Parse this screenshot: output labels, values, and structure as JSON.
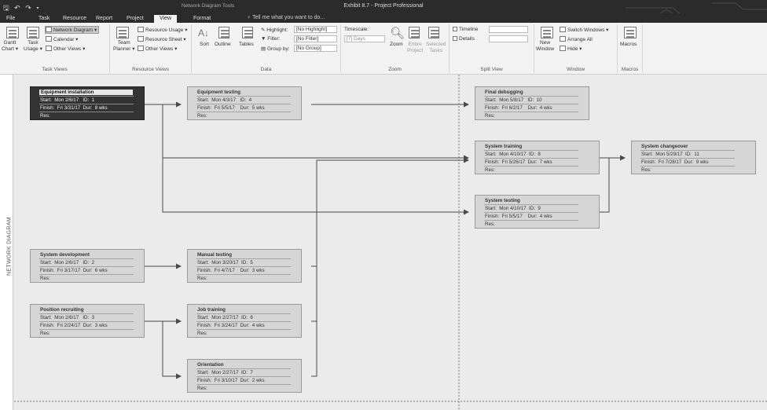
{
  "titlebar": {
    "qat": "🖫 ↶ ↷ ▾",
    "context_tools": "Network Diagram Tools",
    "window_title": "Exhibit 8.7 - Project Professional"
  },
  "tabs": [
    "File",
    "Task",
    "Resource",
    "Report",
    "Project",
    "View",
    "Format"
  ],
  "active_tab": "View",
  "tell_me": "♀ Tell me what you want to do...",
  "ribbon": {
    "task_views": {
      "gantt_chart": "Gantt\nChart ▾",
      "task_usage": "Task\nUsage ▾",
      "network_diagram": "Network Diagram ▾",
      "calendar": "Calendar ▾",
      "other_views": "Other Views ▾",
      "label": "Task Views"
    },
    "resource_views": {
      "team_planner": "Team\nPlanner ▾",
      "resource_usage": "Resource Usage ▾",
      "resource_sheet": "Resource Sheet ▾",
      "other_views": "Other Views ▾",
      "label": "Resource Views"
    },
    "data": {
      "sort": "Sort",
      "outline": "Outline",
      "tables": "Tables",
      "highlight_label": "Highlight:",
      "highlight_value": "[No Highlight]",
      "filter_label": "Filter:",
      "filter_value": "[No Filter]",
      "group_label": "Group by:",
      "group_value": "[No Group]",
      "label": "Data"
    },
    "zoom": {
      "timescale_label": "Timescale:",
      "timescale_value": "[7] Days",
      "zoom": "Zoom",
      "entire_project": "Entire\nProject",
      "selected_tasks": "Selected\nTasks",
      "label": "Zoom"
    },
    "split_view": {
      "timeline": "Timeline",
      "details": "Details",
      "label": "Split View"
    },
    "window": {
      "new_window": "New\nWindow",
      "switch_windows": "Switch Windows ▾",
      "arrange_all": "Arrange All",
      "hide": "Hide ▾",
      "label": "Window"
    },
    "macros": {
      "macros": "Macros",
      "label": "Macros"
    }
  },
  "side_label": "NETWORK DIAGRAM",
  "nodes": [
    {
      "id": "1",
      "name": "Equipment installation",
      "start": "Start:  Mon 2/6/17   ID:  1",
      "finish": "Finish:  Fri 3/31/17  Dur:  8 wks",
      "res": "Res:"
    },
    {
      "id": "2",
      "name": "System development",
      "start": "Start:  Mon 2/6/17   ID:  2",
      "finish": "Finish:  Fri 3/17/17  Dur:  6 wks",
      "res": "Res:"
    },
    {
      "id": "3",
      "name": "Position recruiting",
      "start": "Start:  Mon 2/6/17   ID:  3",
      "finish": "Finish:  Fri 2/24/17  Dur:  3 wks",
      "res": "Res:"
    },
    {
      "id": "4",
      "name": "Equipment testing",
      "start": "Start:  Mon 4/3/17   ID:  4",
      "finish": "Finish:  Fri 5/5/17    Dur:  5 wks",
      "res": "Res:"
    },
    {
      "id": "5",
      "name": "Manual testing",
      "start": "Start:  Mon 3/20/17  ID:  5",
      "finish": "Finish:  Fri 4/7/17    Dur:  3 wks",
      "res": "Res:"
    },
    {
      "id": "6",
      "name": "Job training",
      "start": "Start:  Mon 2/27/17  ID:  6",
      "finish": "Finish:  Fri 3/24/17  Dur:  4 wks",
      "res": "Res:"
    },
    {
      "id": "7",
      "name": "Orientation",
      "start": "Start:  Mon 2/27/17  ID:  7",
      "finish": "Finish:  Fri 3/10/17  Dur:  2 wks",
      "res": "Res:"
    },
    {
      "id": "8",
      "name": "System training",
      "start": "Start:  Mon 4/10/17  ID:  8",
      "finish": "Finish:  Fri 5/26/17  Dur:  7 wks",
      "res": "Res:"
    },
    {
      "id": "9",
      "name": "System testing",
      "start": "Start:  Mon 4/10/17  ID:  9",
      "finish": "Finish:  Fri 5/5/17    Dur:  4 wks",
      "res": "Res:"
    },
    {
      "id": "10",
      "name": "Final debugging",
      "start": "Start:  Mon 5/8/17   ID:  10",
      "finish": "Finish:  Fri 6/2/17    Dur:  4 wks",
      "res": "Res:"
    },
    {
      "id": "11",
      "name": "System changeover",
      "start": "Start:  Mon 5/29/17  ID:  11",
      "finish": "Finish:  Fri 7/28/17  Dur:  9 wks",
      "res": "Res:"
    }
  ],
  "selected_node": "1",
  "colors": {
    "node_fill": "#d6d6d6",
    "selected_fill": "#333333",
    "link_line": "#4a4a4a"
  }
}
